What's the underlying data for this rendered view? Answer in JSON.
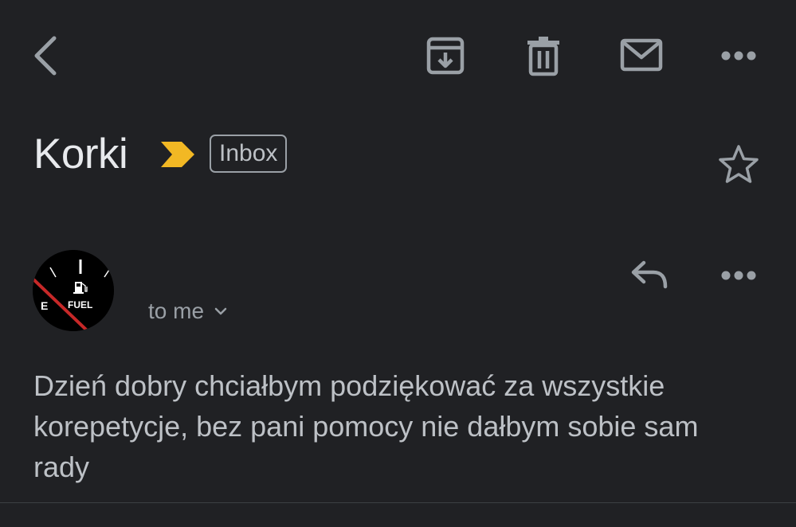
{
  "toolbar": {
    "back_icon": "chevron-left-icon",
    "archive_icon": "archive-icon",
    "delete_icon": "trash-icon",
    "mark_unread_icon": "mail-icon",
    "more_icon": "more-horizontal-icon"
  },
  "email": {
    "subject": "Korki",
    "label": "Inbox",
    "importance_color": "#f2b824",
    "sender_name": "",
    "recipient": "to me",
    "body": "Dzień dobry chciałbym podziękować za wszystkie korepetycje, bez pani pomocy nie dałbym sobie sam rady"
  },
  "avatar": {
    "gauge_empty_label": "E",
    "gauge_label": "FUEL",
    "needle_color": "#c62828"
  },
  "colors": {
    "background": "#202124",
    "icon": "#9aa0a6",
    "text": "#e8eaed"
  }
}
